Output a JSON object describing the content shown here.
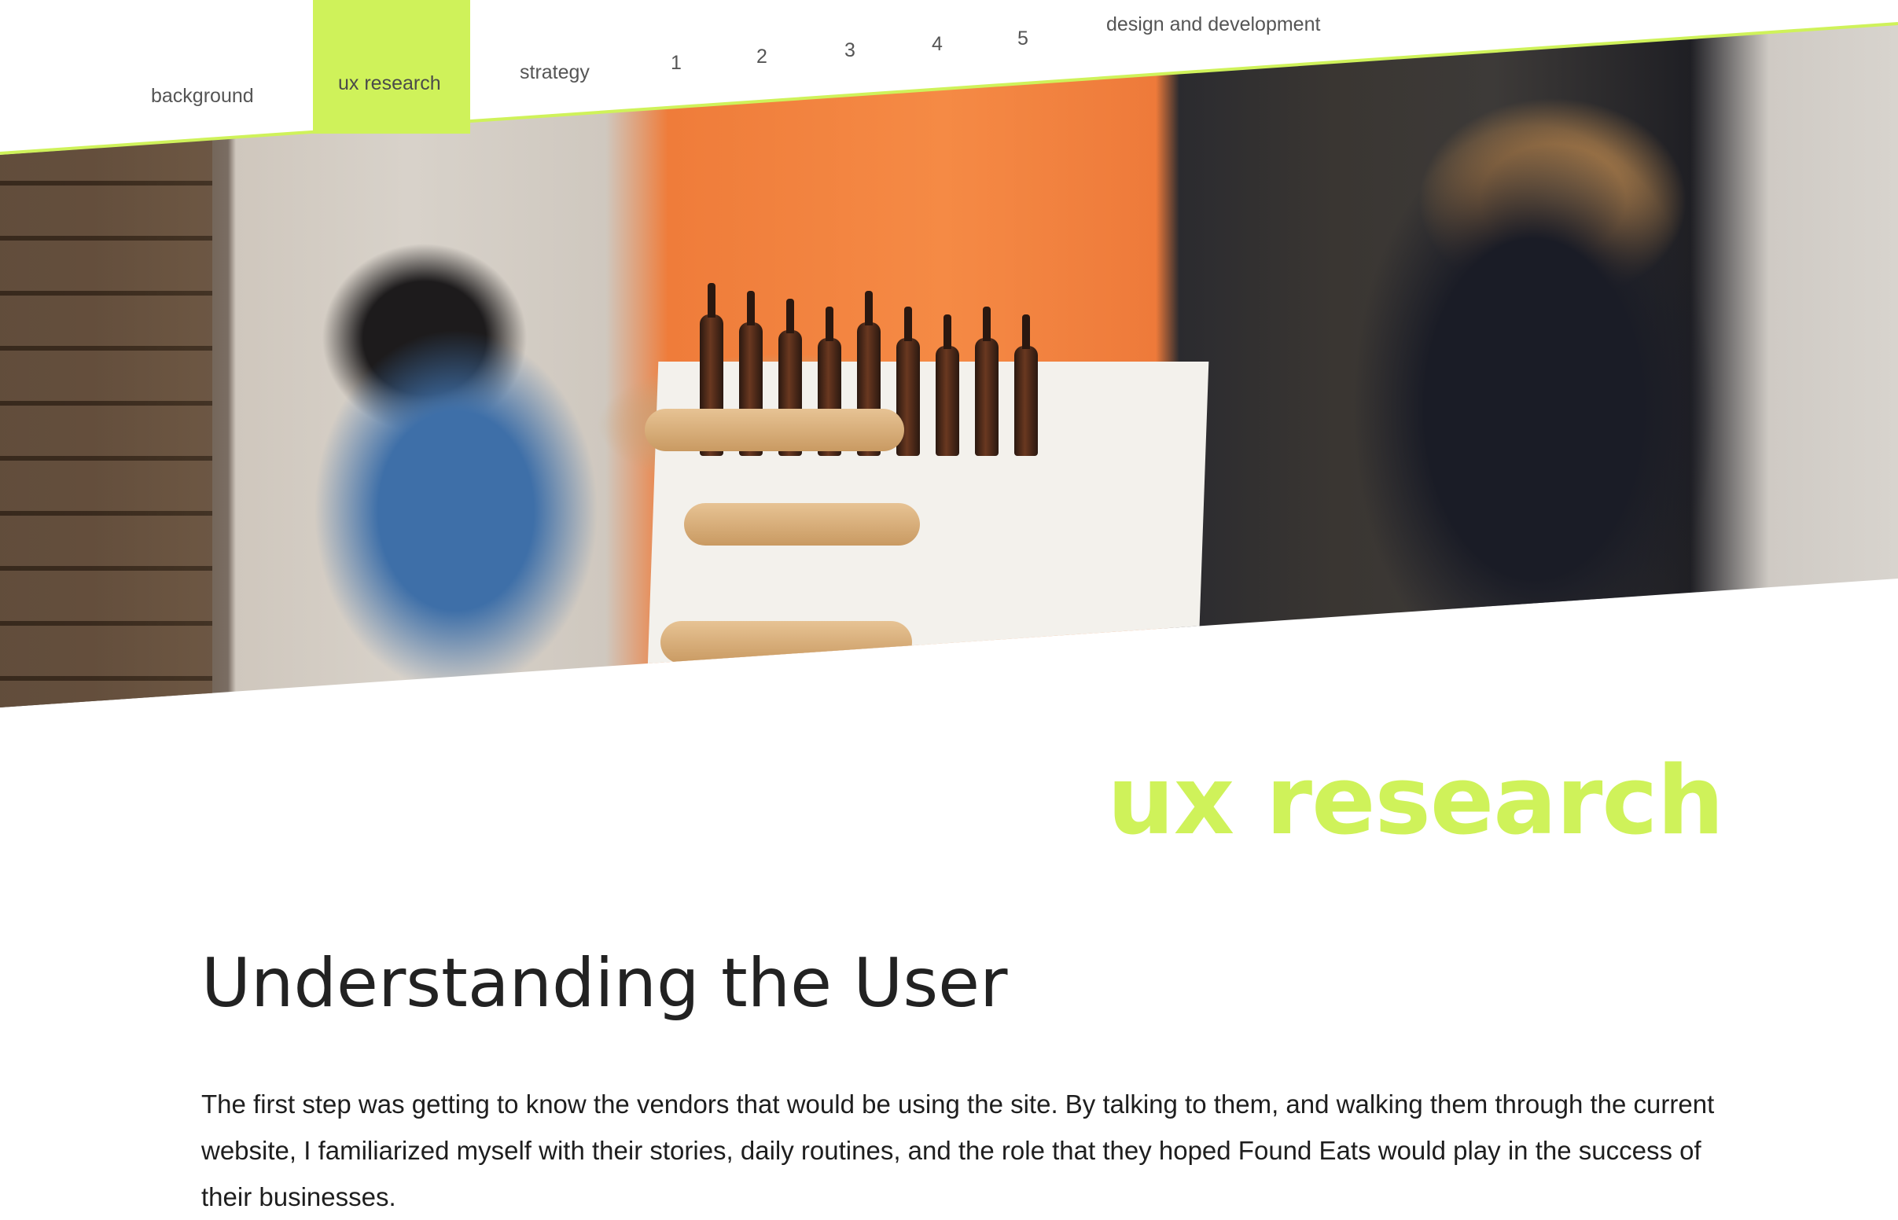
{
  "nav": {
    "items": [
      {
        "label": "background"
      },
      {
        "label": "ux research"
      },
      {
        "label": "strategy"
      },
      {
        "label": "1"
      },
      {
        "label": "2"
      },
      {
        "label": "3"
      },
      {
        "label": "4"
      },
      {
        "label": "5"
      },
      {
        "label": "design and development"
      }
    ],
    "active_item": "ux research"
  },
  "hero": {
    "image_subject": "market vendor reaching for bottles of beer on a table with bread, customer on the right"
  },
  "section": {
    "title": "ux research"
  },
  "content": {
    "heading": "Understanding the User",
    "body": "The first step was getting to know the vendors that would be using the site. By talking to them, and walking them through the current website, I familiarized myself with their stories, daily routines, and the role that they hoped Found Eats would play in the success of their businesses."
  },
  "colors": {
    "accent": "#cff25a",
    "heading": "#222222",
    "body_text": "#1e1e1e",
    "nav_text": "#555555"
  }
}
